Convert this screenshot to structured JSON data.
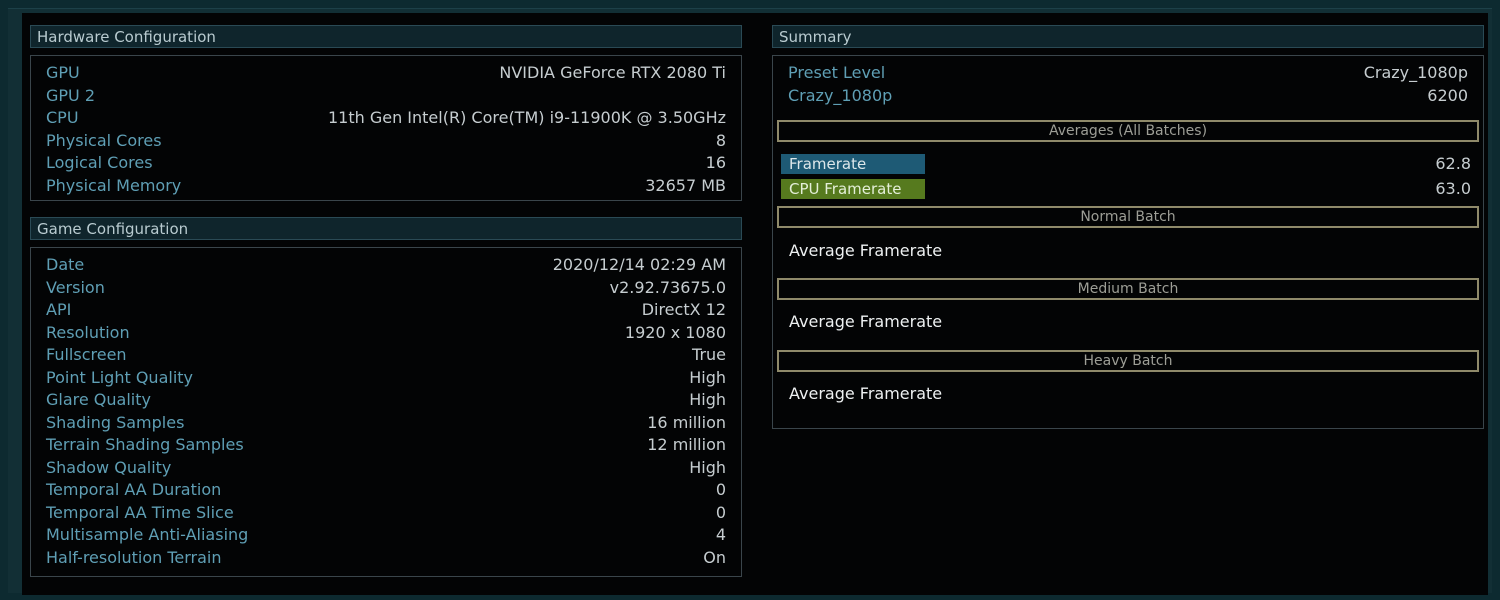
{
  "hardware": {
    "title": "Hardware Configuration",
    "rows": [
      {
        "label": "GPU",
        "value": "NVIDIA GeForce RTX 2080 Ti"
      },
      {
        "label": "GPU 2",
        "value": ""
      },
      {
        "label": "CPU",
        "value": "11th Gen Intel(R) Core(TM) i9-11900K @ 3.50GHz"
      },
      {
        "label": "Physical Cores",
        "value": "8"
      },
      {
        "label": "Logical Cores",
        "value": "16"
      },
      {
        "label": "Physical Memory",
        "value": "32657 MB"
      }
    ]
  },
  "game": {
    "title": "Game Configuration",
    "rows": [
      {
        "label": "Date",
        "value": "2020/12/14 02:29 AM"
      },
      {
        "label": "Version",
        "value": "v2.92.73675.0"
      },
      {
        "label": "API",
        "value": "DirectX 12"
      },
      {
        "label": "Resolution",
        "value": "1920 x 1080"
      },
      {
        "label": "Fullscreen",
        "value": "True"
      },
      {
        "label": "Point Light Quality",
        "value": "High"
      },
      {
        "label": "Glare Quality",
        "value": "High"
      },
      {
        "label": "Shading Samples",
        "value": "16 million"
      },
      {
        "label": "Terrain Shading Samples",
        "value": "12 million"
      },
      {
        "label": "Shadow Quality",
        "value": "High"
      },
      {
        "label": "Temporal AA Duration",
        "value": "0"
      },
      {
        "label": "Temporal AA Time Slice",
        "value": "0"
      },
      {
        "label": "Multisample Anti-Aliasing",
        "value": "4"
      },
      {
        "label": "Half-resolution Terrain",
        "value": "On"
      }
    ]
  },
  "summary": {
    "title": "Summary",
    "rows": [
      {
        "label": "Preset Level",
        "value": "Crazy_1080p"
      },
      {
        "label": "Crazy_1080p",
        "value": "6200"
      }
    ],
    "averages_title": "Averages (All Batches)",
    "averages": [
      {
        "label": "Framerate",
        "value": "62.8",
        "color": "#1e5a75"
      },
      {
        "label": "CPU Framerate",
        "value": "63.0",
        "color": "#567a1e"
      }
    ],
    "batches": [
      {
        "title": "Normal Batch",
        "metric": "Average Framerate"
      },
      {
        "title": "Medium Batch",
        "metric": "Average Framerate"
      },
      {
        "title": "Heavy Batch",
        "metric": "Average Framerate"
      }
    ]
  }
}
